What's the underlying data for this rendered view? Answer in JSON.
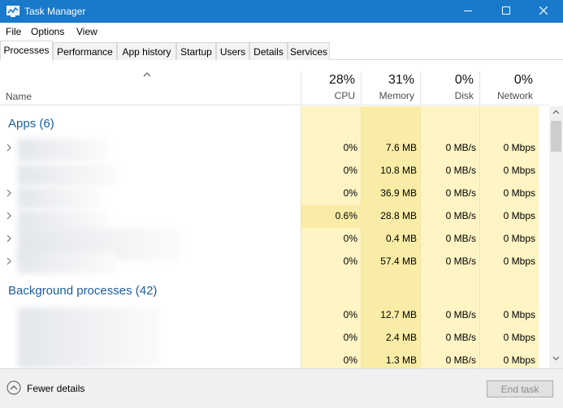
{
  "window": {
    "title": "Task Manager"
  },
  "menu": [
    "File",
    "Options",
    "View"
  ],
  "tabs": [
    "Processes",
    "Performance",
    "App history",
    "Startup",
    "Users",
    "Details",
    "Services"
  ],
  "header": {
    "name_label": "Name",
    "columns": [
      {
        "pct": "28%",
        "label": "CPU"
      },
      {
        "pct": "31%",
        "label": "Memory"
      },
      {
        "pct": "0%",
        "label": "Disk"
      },
      {
        "pct": "0%",
        "label": "Network"
      }
    ]
  },
  "groups": {
    "apps": "Apps (6)",
    "background": "Background processes (42)"
  },
  "app_rows": [
    {
      "cpu": "0%",
      "memory": "7.6 MB",
      "disk": "0 MB/s",
      "network": "0 Mbps",
      "expandable": true
    },
    {
      "cpu": "0%",
      "memory": "10.8 MB",
      "disk": "0 MB/s",
      "network": "0 Mbps",
      "expandable": false
    },
    {
      "cpu": "0%",
      "memory": "36.9 MB",
      "disk": "0 MB/s",
      "network": "0 Mbps",
      "expandable": true
    },
    {
      "cpu": "0.6%",
      "memory": "28.8 MB",
      "disk": "0 MB/s",
      "network": "0 Mbps",
      "expandable": true
    },
    {
      "cpu": "0%",
      "memory": "0.4 MB",
      "disk": "0 MB/s",
      "network": "0 Mbps",
      "expandable": true
    },
    {
      "cpu": "0%",
      "memory": "57.4 MB",
      "disk": "0 MB/s",
      "network": "0 Mbps",
      "expandable": true
    }
  ],
  "background_rows": [
    {
      "cpu": "0%",
      "memory": "12.7 MB",
      "disk": "0 MB/s",
      "network": "0 Mbps"
    },
    {
      "cpu": "0%",
      "memory": "2.4 MB",
      "disk": "0 MB/s",
      "network": "0 Mbps"
    },
    {
      "cpu": "0%",
      "memory": "1.3 MB",
      "disk": "0 MB/s",
      "network": "0 Mbps"
    }
  ],
  "footer": {
    "fewer_details": "Fewer details",
    "end_task": "End task"
  },
  "colors": {
    "titlebar": "#1979ca",
    "group_title": "#1b5e9c",
    "column_highlight": "#fff4c4",
    "cell_heat": "#f9eca6"
  },
  "icons": {
    "app": "task-manager-app-icon",
    "expand": "chevron-right-icon",
    "sort": "chevron-up-icon",
    "fewer": "chevron-up-circle-icon"
  }
}
